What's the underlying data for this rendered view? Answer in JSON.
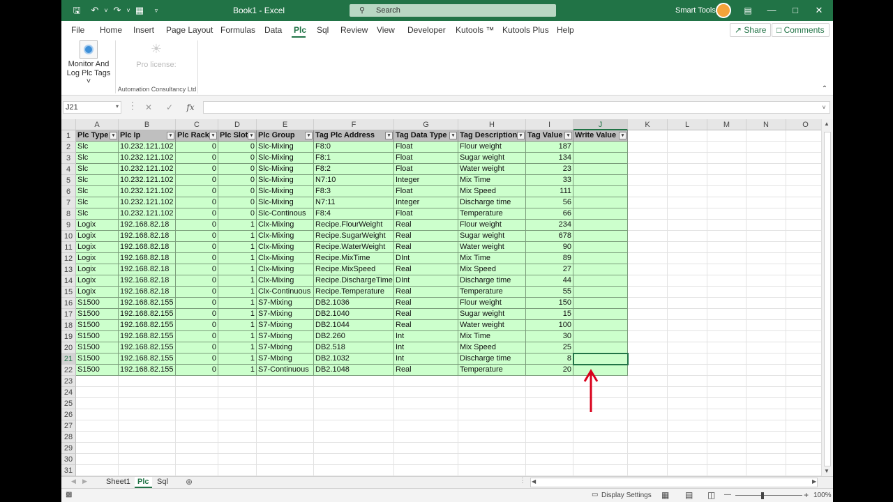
{
  "titlebar": {
    "doc_title": "Book1  -  Excel",
    "search_placeholder": "Search",
    "user_name": "Smart Tools",
    "accent": "#217346"
  },
  "menu": {
    "items": [
      "File",
      "Home",
      "Insert",
      "Page Layout",
      "Formulas",
      "Data",
      "Plc",
      "Sql",
      "Review",
      "View",
      "Developer",
      "Kutools ™",
      "Kutools Plus",
      "Help"
    ],
    "active": "Plc",
    "share_label": "Share",
    "comments_label": "Comments"
  },
  "ribbon": {
    "monitor_label_1": "Monitor And",
    "monitor_label_2": "Log Plc Tags ˅",
    "pro_license_label": "Pro license:",
    "group_label": "Automation Consultancy Ltd"
  },
  "formula_bar": {
    "name_box": "J21",
    "formula": ""
  },
  "columns": [
    "A",
    "B",
    "C",
    "D",
    "E",
    "F",
    "G",
    "H",
    "I",
    "J",
    "K",
    "L",
    "M",
    "N",
    "O"
  ],
  "selected_column": "J",
  "selected_row": 21,
  "row_numbers": [
    1,
    2,
    3,
    4,
    5,
    6,
    7,
    8,
    9,
    10,
    11,
    12,
    13,
    14,
    15,
    16,
    17,
    18,
    19,
    20,
    21,
    22,
    23,
    24,
    25,
    26,
    27,
    28,
    29,
    30,
    31
  ],
  "table": {
    "headers": [
      "Plc Type",
      "Plc Ip",
      "Plc Rack",
      "Plc Slot",
      "Plc Group",
      "Tag Plc Address",
      "Tag Data Type",
      "Tag Description",
      "Tag Value",
      "Write Value"
    ],
    "rows": [
      [
        "Slc",
        "10.232.121.102",
        "0",
        "0",
        "Slc-Mixing",
        "F8:0",
        "Float",
        "Flour weight",
        "187",
        ""
      ],
      [
        "Slc",
        "10.232.121.102",
        "0",
        "0",
        "Slc-Mixing",
        "F8:1",
        "Float",
        "Sugar weight",
        "134",
        ""
      ],
      [
        "Slc",
        "10.232.121.102",
        "0",
        "0",
        "Slc-Mixing",
        "F8:2",
        "Float",
        "Water weight",
        "23",
        ""
      ],
      [
        "Slc",
        "10.232.121.102",
        "0",
        "0",
        "Slc-Mixing",
        "N7:10",
        "Integer",
        "Mix Time",
        "33",
        ""
      ],
      [
        "Slc",
        "10.232.121.102",
        "0",
        "0",
        "Slc-Mixing",
        "F8:3",
        "Float",
        "Mix Speed",
        "111",
        ""
      ],
      [
        "Slc",
        "10.232.121.102",
        "0",
        "0",
        "Slc-Mixing",
        "N7:11",
        "Integer",
        "Discharge time",
        "56",
        ""
      ],
      [
        "Slc",
        "10.232.121.102",
        "0",
        "0",
        "Slc-Continous",
        "F8:4",
        "Float",
        "Temperature",
        "66",
        ""
      ],
      [
        "Logix",
        "192.168.82.18",
        "0",
        "1",
        "Clx-Mixing",
        "Recipe.FlourWeight",
        "Real",
        "Flour weight",
        "234",
        ""
      ],
      [
        "Logix",
        "192.168.82.18",
        "0",
        "1",
        "Clx-Mixing",
        "Recipe.SugarWeight",
        "Real",
        "Sugar weight",
        "678",
        ""
      ],
      [
        "Logix",
        "192.168.82.18",
        "0",
        "1",
        "Clx-Mixing",
        "Recipe.WaterWeight",
        "Real",
        "Water weight",
        "90",
        ""
      ],
      [
        "Logix",
        "192.168.82.18",
        "0",
        "1",
        "Clx-Mixing",
        "Recipe.MixTime",
        "DInt",
        "Mix Time",
        "89",
        ""
      ],
      [
        "Logix",
        "192.168.82.18",
        "0",
        "1",
        "Clx-Mixing",
        "Recipe.MixSpeed",
        "Real",
        "Mix Speed",
        "27",
        ""
      ],
      [
        "Logix",
        "192.168.82.18",
        "0",
        "1",
        "Clx-Mixing",
        "Recipe.DischargeTime",
        "DInt",
        "Discharge time",
        "44",
        ""
      ],
      [
        "Logix",
        "192.168.82.18",
        "0",
        "1",
        "Clx-Continuous",
        "Recipe.Temperature",
        "Real",
        "Temperature",
        "55",
        ""
      ],
      [
        "S1500",
        "192.168.82.155",
        "0",
        "1",
        "S7-Mixing",
        "DB2.1036",
        "Real",
        "Flour weight",
        "150",
        ""
      ],
      [
        "S1500",
        "192.168.82.155",
        "0",
        "1",
        "S7-Mixing",
        "DB2.1040",
        "Real",
        "Sugar weight",
        "15",
        ""
      ],
      [
        "S1500",
        "192.168.82.155",
        "0",
        "1",
        "S7-Mixing",
        "DB2.1044",
        "Real",
        "Water weight",
        "100",
        ""
      ],
      [
        "S1500",
        "192.168.82.155",
        "0",
        "1",
        "S7-Mixing",
        "DB2.260",
        "Int",
        "Mix Time",
        "30",
        ""
      ],
      [
        "S1500",
        "192.168.82.155",
        "0",
        "1",
        "S7-Mixing",
        "DB2.518",
        "Int",
        "Mix Speed",
        "25",
        ""
      ],
      [
        "S1500",
        "192.168.82.155",
        "0",
        "1",
        "S7-Mixing",
        "DB2.1032",
        "Int",
        "Discharge time",
        "8",
        ""
      ],
      [
        "S1500",
        "192.168.82.155",
        "0",
        "1",
        "S7-Continuous",
        "DB2.1048",
        "Real",
        "Temperature",
        "20",
        ""
      ]
    ],
    "numeric_columns": [
      2,
      3,
      8
    ],
    "table_fill": "#ccffcc",
    "header_fill": "#bfbfbf"
  },
  "annotation": {
    "arrow_color": "#d9001b"
  },
  "sheets": {
    "tabs": [
      "Sheet1",
      "Plc",
      "Sql"
    ],
    "active": "Plc",
    "add_icon": "⊕"
  },
  "status": {
    "display_settings": "Display Settings",
    "zoom": "100%"
  }
}
